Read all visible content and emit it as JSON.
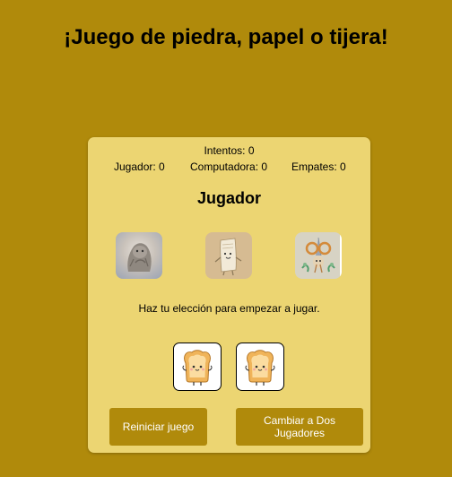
{
  "page": {
    "title": "¡Juego de piedra, papel o tijera!"
  },
  "scoreboard": {
    "attempts": "Intentos: 0",
    "player": "Jugador: 0",
    "computer": "Computadora: 0",
    "ties": "Empates: 0"
  },
  "turn_heading": "Jugador",
  "choices": [
    {
      "name": "piedra",
      "icon": "rock-icon"
    },
    {
      "name": "papel",
      "icon": "paper-icon"
    },
    {
      "name": "tijera",
      "icon": "scissors-icon"
    }
  ],
  "message": "Haz tu elección para empezar a jugar.",
  "results": {
    "player_icon": "toast-icon",
    "computer_icon": "toast-icon"
  },
  "buttons": {
    "restart": "Reiniciar juego",
    "switch_mode": "Cambiar a Dos Jugadores"
  },
  "colors": {
    "background": "#b08a0b",
    "card": "#ecd572",
    "button": "#b08a0b"
  }
}
